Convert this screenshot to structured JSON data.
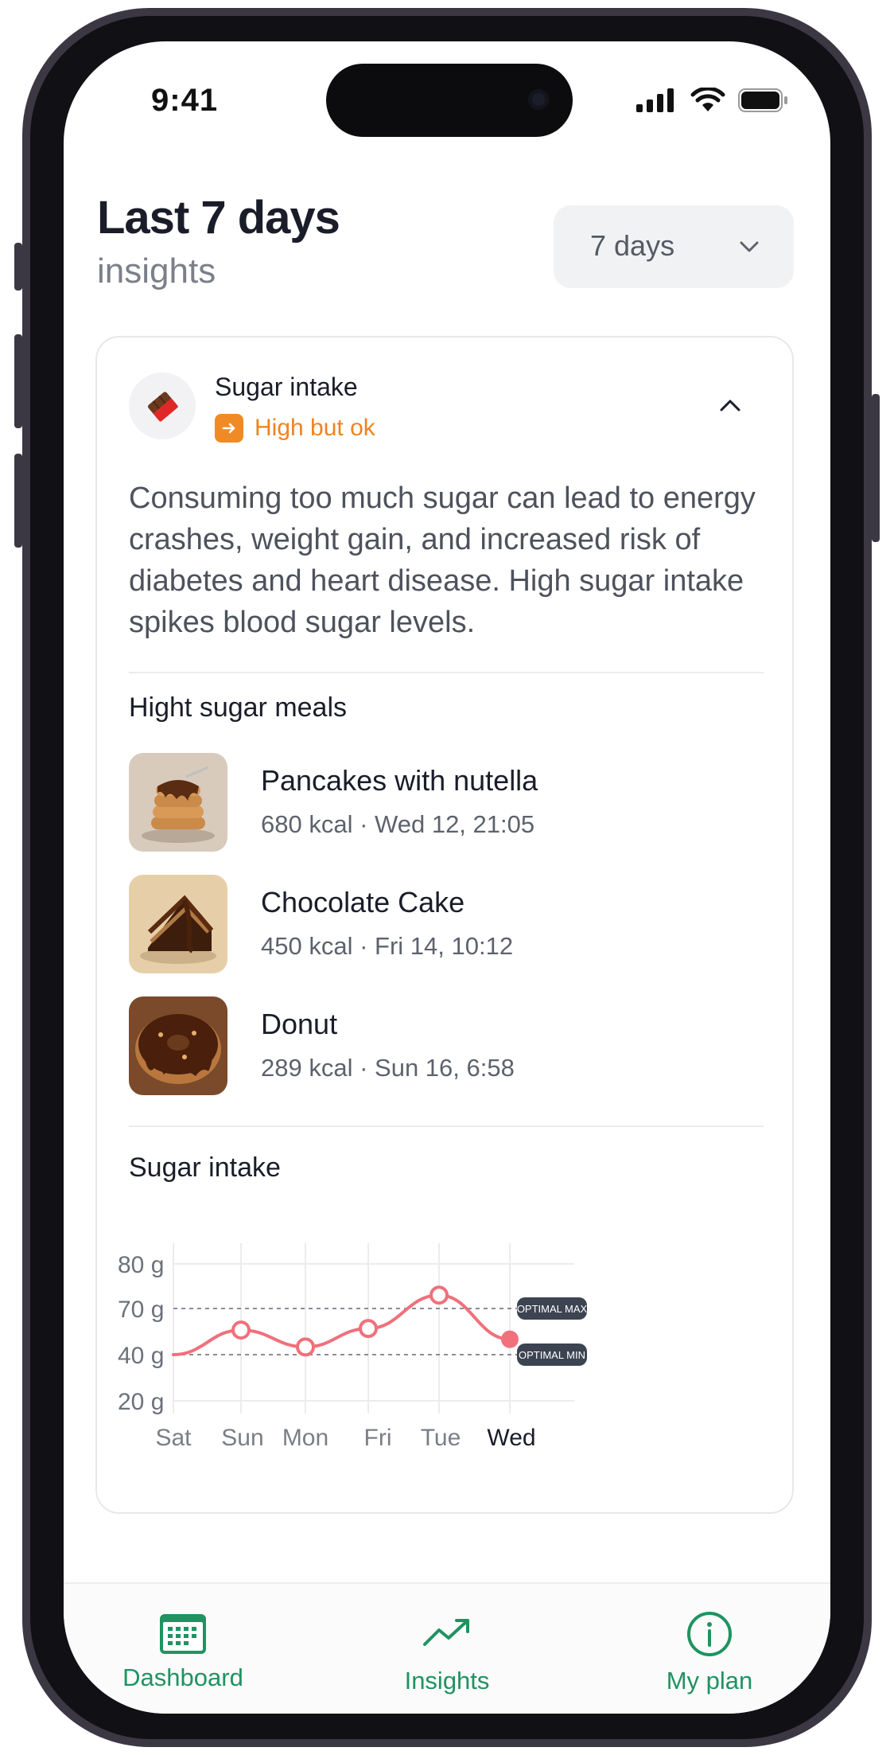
{
  "status_bar": {
    "time": "9:41",
    "icons": [
      "cellular-signal-icon",
      "wifi-icon",
      "battery-icon"
    ]
  },
  "header": {
    "title": "Last 7 days",
    "subtitle": "insights",
    "period_select": {
      "value": "7 days",
      "icon": "chevron-down-icon"
    }
  },
  "card": {
    "icon": "chocolate-icon",
    "name": "Sugar intake",
    "status": {
      "label": "High but ok",
      "icon": "arrow-right-icon",
      "color": "#f08a24"
    },
    "collapse_icon": "chevron-up-icon",
    "description": "Consuming too much sugar can lead to energy crashes, weight gain, and increased risk of diabetes and heart disease. High sugar intake spikes blood sugar levels.",
    "meals_title": "Hight sugar meals",
    "meals": [
      {
        "name": "Pancakes with nutella",
        "kcal": "680 kcal",
        "time": "Wed 12, 21:05",
        "image": "pancakes-image"
      },
      {
        "name": "Chocolate Cake",
        "kcal": "450 kcal",
        "time": "Fri 14, 10:12",
        "image": "chocolate-cake-image"
      },
      {
        "name": "Donut",
        "kcal": "289 kcal",
        "time": "Sun 16, 6:58",
        "image": "donut-image"
      }
    ],
    "chart_title": "Sugar intake"
  },
  "chart_data": {
    "type": "line",
    "title": "Sugar intake",
    "categories": [
      "Sat",
      "Sun",
      "Mon",
      "Fri",
      "Tue",
      "Wed"
    ],
    "y_tick_labels": [
      "80 g",
      "70 g",
      "40 g",
      "20 g"
    ],
    "series": [
      {
        "values": [
          40,
          56,
          45,
          57,
          73,
          50
        ],
        "color": "#f0707c"
      }
    ],
    "reference_lines": [
      {
        "label": "OPTIMAL MAX",
        "value": 70
      },
      {
        "label": "OPTIMAL MIN",
        "value": 40
      }
    ],
    "highlighted_category": "Wed",
    "grid": true
  },
  "tabbar": {
    "tabs": [
      {
        "label": "Dashboard",
        "icon": "calendar-icon",
        "active": true
      },
      {
        "label": "Insights",
        "icon": "trending-up-icon",
        "active": false
      },
      {
        "label": "My plan",
        "icon": "info-icon",
        "active": false
      }
    ],
    "accent": "#1f9360"
  }
}
